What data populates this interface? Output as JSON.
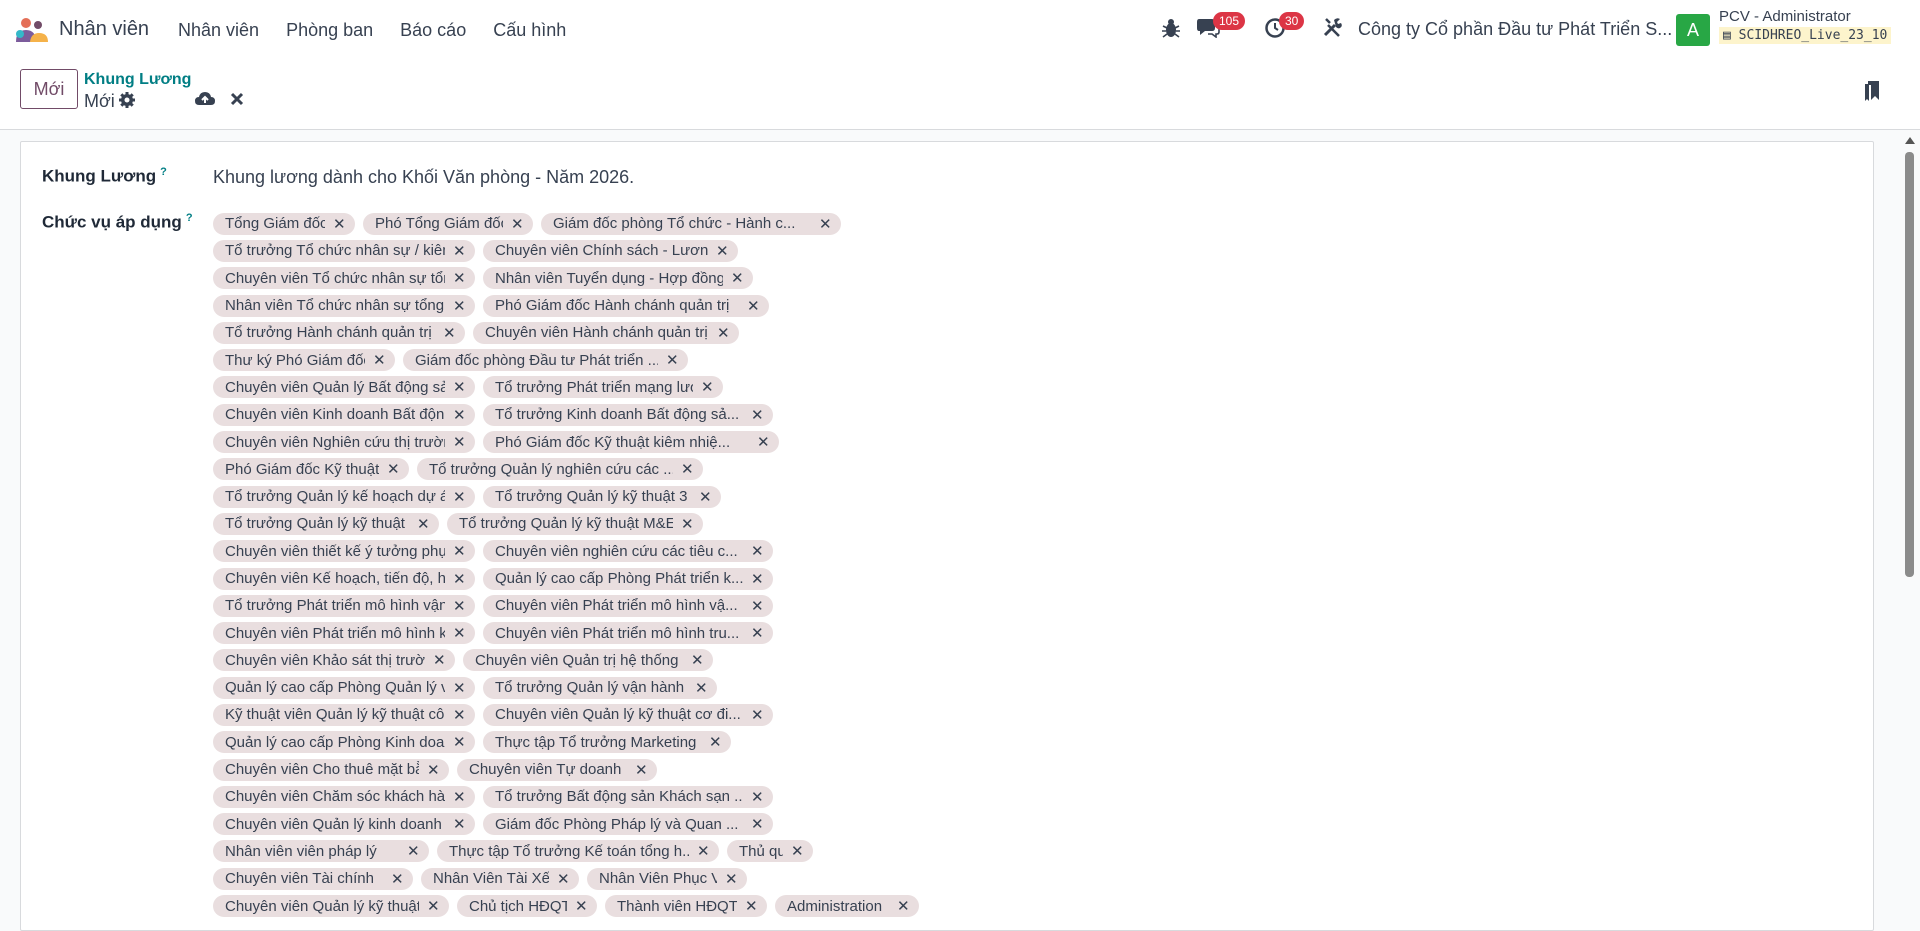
{
  "app": {
    "name": "Nhân viên"
  },
  "menu": [
    "Nhân viên",
    "Phòng ban",
    "Báo cáo",
    "Cấu hình"
  ],
  "systray": {
    "messages_count": "105",
    "activities_count": "30",
    "company": "Công ty Cổ phần Đầu tư Phát Triển S...",
    "avatar_letter": "A",
    "user_name": "PCV - Administrator",
    "db_name": "SCIDHREO_Live_23_10"
  },
  "control": {
    "new_label": "Mới",
    "breadcrumb_parent": "Khung Lương",
    "breadcrumb_current": "Mới"
  },
  "form": {
    "name_label": "Khung Lương",
    "name_help": "?",
    "name_value": "Khung lương dành cho Khối Văn phòng - Năm 2026.",
    "positions_label": "Chức vụ áp dụng",
    "positions_help": "?",
    "tag_remove": "✕",
    "position_rows": [
      [
        "Tổng Giám đốc",
        "Phó Tổng Giám đốc",
        "Giám đốc phòng Tổ chức - Hành c..."
      ],
      [
        "Tổ trưởng Tổ chức nhân sự / kiêm ...",
        "Chuyên viên Chính sách - Lương"
      ],
      [
        "Chuyên viên Tổ chức nhân sự tổng ...",
        "Nhân viên Tuyển dụng - Hợp đồng"
      ],
      [
        "Nhân viên Tổ chức nhân sự tổng h...",
        "Phó Giám đốc Hành chánh quản trị"
      ],
      [
        "Tổ trưởng Hành chánh quản trị",
        "Chuyên viên Hành chánh quản trị"
      ],
      [
        "Thư ký Phó Giám đốc",
        "Giám đốc phòng Đầu tư Phát triển ..."
      ],
      [
        "Chuyên viên Quản lý Bất động sản",
        "Tổ trưởng Phát triển mạng lưới"
      ],
      [
        "Chuyên viên Kinh doanh Bất động ...",
        "Tổ trưởng Kinh doanh Bất động sả..."
      ],
      [
        "Chuyên viên Nghiên cứu thị trường",
        "Phó Giám đốc Kỹ thuật kiêm nhiệ..."
      ],
      [
        "Phó Giám đốc Kỹ thuật",
        "Tổ trưởng Quản lý nghiên cứu các ..."
      ],
      [
        "Tổ trưởng Quản lý kế hoạch dự án",
        "Tổ trưởng Quản lý kỹ thuật 3"
      ],
      [
        "Tổ trưởng Quản lý kỹ thuật 2",
        "Tổ trưởng Quản lý kỹ thuật M&E"
      ],
      [
        "Chuyên viên thiết kế ý tưởng phục ...",
        "Chuyên viên nghiên cứu các tiêu c..."
      ],
      [
        "Chuyên viên Kế hoạch, tiến độ, hợ...",
        "Quản lý cao cấp Phòng Phát triển k..."
      ],
      [
        "Tổ trưởng Phát triển mô hình vận ...",
        "Chuyên viên Phát triển mô hình vậ..."
      ],
      [
        "Chuyên viên Phát triển mô hình kin...",
        "Chuyên viên Phát triển mô hình tru..."
      ],
      [
        "Chuyên viên Khảo sát thị trường",
        "Chuyên viên Quản trị hệ thống"
      ],
      [
        "Quản lý cao cấp Phòng Quản lý vậ...",
        "Tổ trưởng Quản lý vận hành"
      ],
      [
        "Kỹ thuật viên Quản lý kỹ thuật côn...",
        "Chuyên viên Quản lý kỹ thuật cơ đi..."
      ],
      [
        "Quản lý cao cấp Phòng Kinh doanh...",
        "Thực tập Tổ trưởng Marketing"
      ],
      [
        "Chuyên viên Cho thuê mặt bằng",
        "Chuyên viên Tự doanh"
      ],
      [
        "Chuyên viên Chăm sóc khách hàng...",
        "Tổ trưởng Bất động sản Khách sạn ..."
      ],
      [
        "Chuyên viên Quản lý kinh doanh k...",
        "Giám đốc Phòng Pháp lý và Quan ..."
      ],
      [
        "Nhân viên viên pháp lý",
        "Thực tập Tổ trưởng Kế toán tổng h...",
        "Thủ quỹ"
      ],
      [
        "Chuyên viên Tài chính",
        "Nhân Viên Tài Xế",
        "Nhân Viên Phục Vụ"
      ],
      [
        "Chuyên viên Quản lý kỹ thuật",
        "Chủ tịch HĐQT",
        "Thành viên HĐQT",
        "Administration"
      ]
    ]
  },
  "colors": {
    "brand": "#714b67",
    "link": "#017e84",
    "badge": "#dc3545",
    "avatar": "#28a745",
    "tag_bg": "#e9dedf"
  },
  "icons": [
    "bug-icon",
    "chat-icon",
    "clock-icon",
    "tools-icon",
    "gear-icon",
    "cloud-upload-icon",
    "close-icon",
    "bookmark-icon",
    "database-icon"
  ]
}
